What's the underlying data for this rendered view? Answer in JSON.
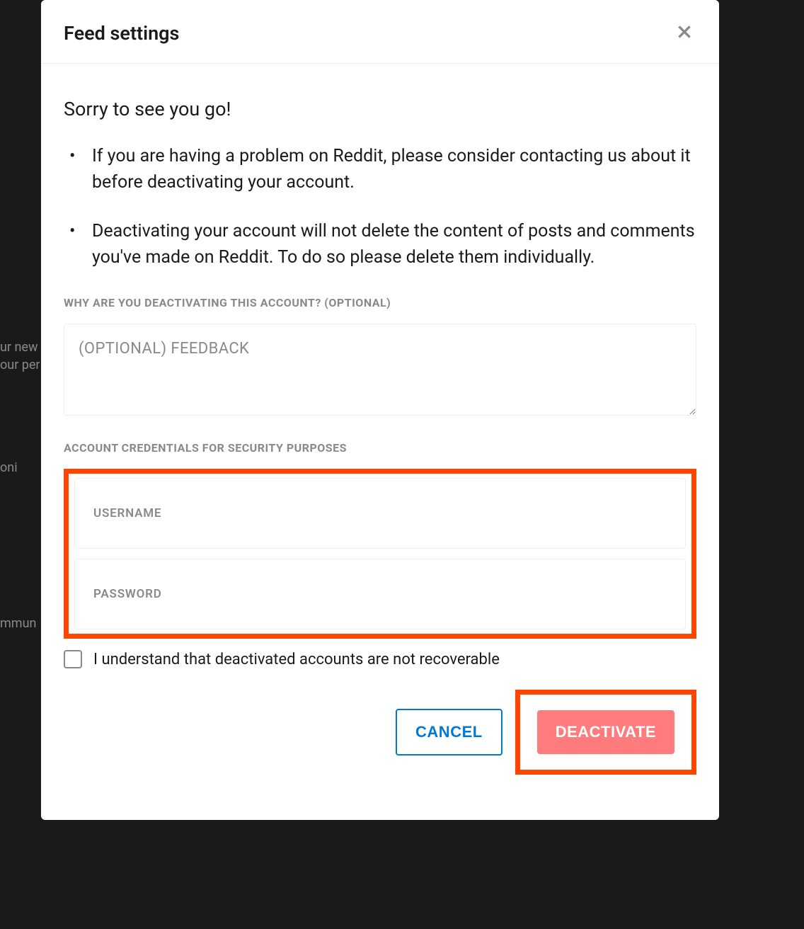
{
  "background": {
    "line1": "ur new",
    "line2": "our per",
    "line3": "oni",
    "line4": "mmun"
  },
  "modal": {
    "title": "Feed settings",
    "sorry": "Sorry to see you go!",
    "bullets": [
      "If you are having a problem on Reddit, please consider contacting us about it before deactivating your account.",
      "Deactivating your account will not delete the content of posts and comments you've made on Reddit. To do so please delete them individually."
    ],
    "reason_label": "WHY ARE YOU DEACTIVATING THIS ACCOUNT? (OPTIONAL)",
    "feedback_placeholder": "(OPTIONAL) FEEDBACK",
    "credentials_label": "ACCOUNT CREDENTIALS FOR SECURITY PURPOSES",
    "username_placeholder": "USERNAME",
    "password_placeholder": "PASSWORD",
    "checkbox_label": "I understand that deactivated accounts are not recoverable",
    "cancel_label": "CANCEL",
    "deactivate_label": "DEACTIVATE"
  }
}
